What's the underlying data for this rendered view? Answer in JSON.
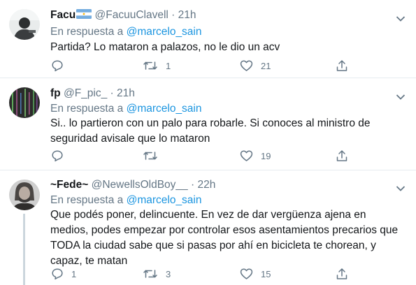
{
  "tweets": [
    {
      "display_name": "Facu",
      "has_flag": true,
      "handle": "@FacuuClavell",
      "separator": "·",
      "time": "21h",
      "reply_prefix": "En respuesta a",
      "reply_to": "@marcelo_sain",
      "text": "Partida? Lo mataron a palazos, no le dio un acv",
      "replies": "",
      "retweets": "1",
      "likes": "21"
    },
    {
      "display_name": "fp",
      "has_flag": false,
      "handle": "@F_pic_",
      "separator": "·",
      "time": "21h",
      "reply_prefix": "En respuesta a",
      "reply_to": "@marcelo_sain",
      "text": "Si.. lo partieron con un palo para robarle. Si conoces al ministro de seguridad avisale que lo mataron",
      "replies": "",
      "retweets": "",
      "likes": "19"
    },
    {
      "display_name": "~Fede~",
      "has_flag": false,
      "handle": "@NewellsOldBoy__",
      "separator": "·",
      "time": "22h",
      "reply_prefix": "En respuesta a",
      "reply_to": "@marcelo_sain",
      "text": "Que podés poner, delincuente. En vez de dar vergüenza ajena en medios, podes empezar por controlar esos asentamientos precarios que TODA la ciudad sabe que si pasas por ahí en bicicleta te chorean, y capaz, te matan",
      "replies": "1",
      "retweets": "3",
      "likes": "15"
    }
  ],
  "icons": {
    "reply": "speech-bubble-icon",
    "retweet": "retweet-arrows-icon",
    "like": "heart-icon",
    "share": "share-upload-icon",
    "menu": "chevron-down-icon"
  },
  "colors": {
    "text": "#14171a",
    "secondary": "#657786",
    "mention": "#1b95e0",
    "divider": "#e6ecf0"
  }
}
